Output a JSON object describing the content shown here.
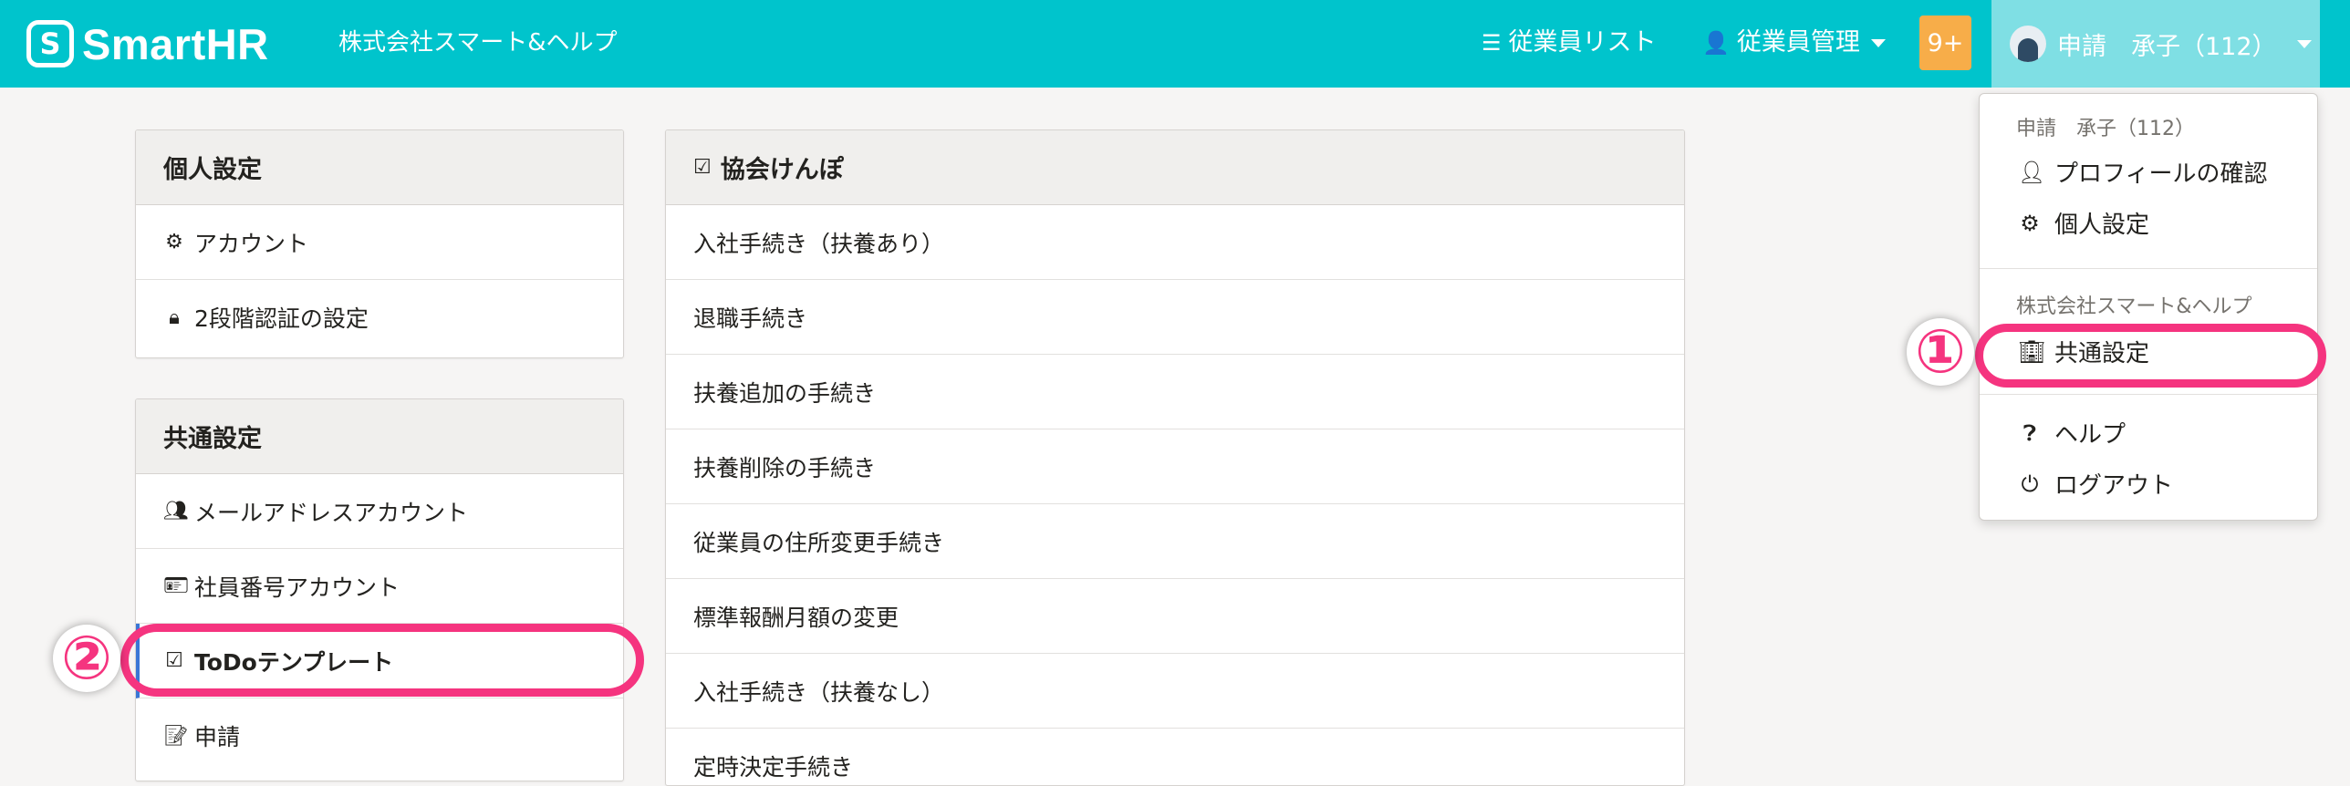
{
  "header": {
    "logo_mark": "S",
    "logo_text": "SmartHR",
    "company_name": "株式会社スマート&ヘルプ",
    "nav": {
      "employee_list": "従業員リスト",
      "employee_management": "従業員管理"
    },
    "notification_badge": "9+",
    "user_name": "申請　承子（112）"
  },
  "personal_settings": {
    "title": "個人設定",
    "items": [
      {
        "label": "アカウント",
        "icon": "gear-icon"
      },
      {
        "label": "2段階認証の設定",
        "icon": "lock-icon"
      }
    ]
  },
  "common_settings": {
    "title": "共通設定",
    "items": [
      {
        "label": "メールアドレスアカウント",
        "icon": "users-icon"
      },
      {
        "label": "社員番号アカウント",
        "icon": "id-card-icon"
      },
      {
        "label": "ToDoテンプレート",
        "icon": "check-square-icon"
      },
      {
        "label": "申請",
        "icon": "document-check-icon"
      }
    ]
  },
  "kyokai_kenpo": {
    "title": "協会けんぽ",
    "items": [
      "入社手続き（扶養あり）",
      "退職手続き",
      "扶養追加の手続き",
      "扶養削除の手続き",
      "従業員の住所変更手続き",
      "標準報酬月額の変更",
      "入社手続き（扶養なし）",
      "定時決定手続き"
    ]
  },
  "dropdown": {
    "user_label": "申請　承子（112）",
    "profile": "プロフィールの確認",
    "personal_settings": "個人設定",
    "company_label": "株式会社スマート&ヘルプ",
    "common_settings": "共通設定",
    "help": "ヘルプ",
    "logout": "ログアウト"
  },
  "annotations": {
    "step1": "①",
    "step2": "②"
  },
  "colors": {
    "header_bg": "#00c4cc",
    "user_menu_bg": "#7fdfe4",
    "badge_bg": "#f7ad49",
    "highlight": "#f5347f",
    "active_indicator": "#3a76d6"
  }
}
